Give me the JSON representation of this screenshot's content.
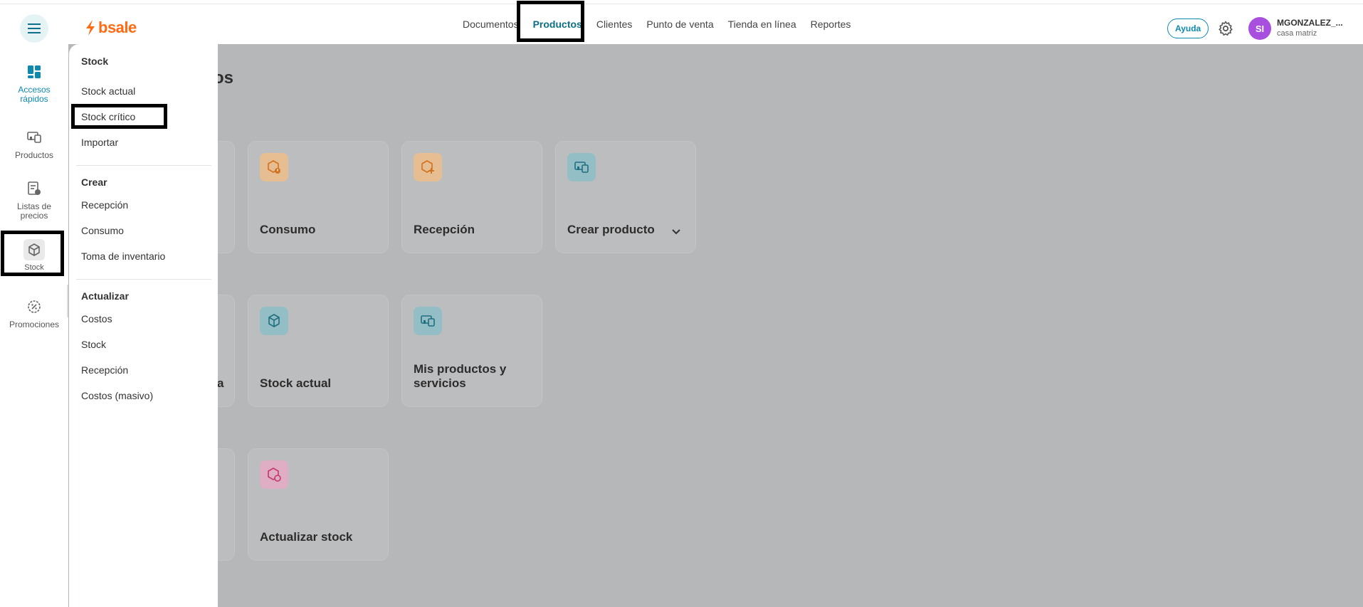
{
  "header": {
    "logo_text": "bsale",
    "nav": [
      "Documentos",
      "Productos",
      "Clientes",
      "Punto de venta",
      "Tienda en línea",
      "Reportes"
    ],
    "active_nav": "Productos",
    "help_label": "Ayuda",
    "user": {
      "initials": "SI",
      "name": "MGONZALEZ_...",
      "branch": "casa matriz"
    }
  },
  "rail": {
    "items": [
      {
        "label": "Accesos rápidos",
        "icon": "dashboard-icon"
      },
      {
        "label": "Productos",
        "icon": "products-icon"
      },
      {
        "label": "Listas de precios",
        "icon": "price-list-icon"
      },
      {
        "label": "Stock",
        "icon": "box-icon"
      },
      {
        "label": "Promociones",
        "icon": "promotions-icon"
      }
    ],
    "active": "Accesos rápidos",
    "selected": "Stock"
  },
  "submenu": {
    "sections": [
      {
        "title": "Stock",
        "items": [
          "Stock actual",
          "Stock crítico",
          "Importar"
        ]
      },
      {
        "title": "Crear",
        "items": [
          "Recepción",
          "Consumo",
          "Toma de inventario"
        ]
      },
      {
        "title": "Actualizar",
        "items": [
          "Costos",
          "Stock",
          "Recepción",
          "Costos (masivo)"
        ]
      }
    ]
  },
  "main": {
    "title_fragment": "os",
    "partial_label": "a",
    "cards": [
      {
        "title": "Consumo",
        "icon": "box-alert-icon",
        "color": "#f0b37a"
      },
      {
        "title": "Recepción",
        "icon": "box-plus-icon",
        "color": "#f0b37a"
      },
      {
        "title": "Crear producto",
        "icon": "products-icon",
        "color": "#7fb8c4"
      },
      {
        "title": "Stock actual",
        "icon": "box-icon",
        "color": "#7fb8c4"
      },
      {
        "title": "Mis productos y servicios",
        "icon": "products-icon",
        "color": "#7fb8c4"
      },
      {
        "title": "Actualizar stock",
        "icon": "box-refresh-icon",
        "color": "#e6a1bf"
      }
    ]
  },
  "colors": {
    "brand": "#ff6a13",
    "accent": "#0e8ab0",
    "overlay": "#b6b7b9"
  }
}
